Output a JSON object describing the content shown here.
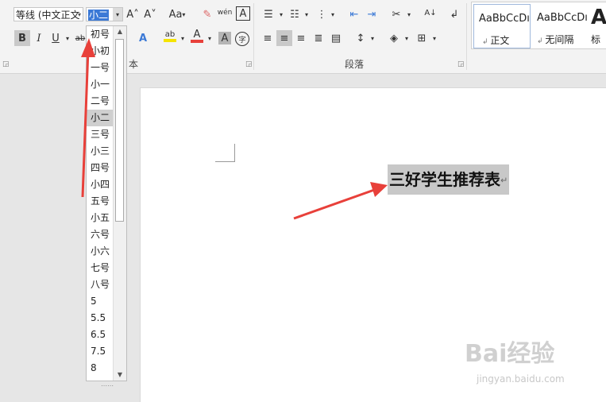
{
  "font_group": {
    "font_name": "等线 (中文正文",
    "font_size": "小二",
    "grow_icon": "A˄",
    "shrink_icon": "A˅",
    "case_label": "Aa",
    "phonetic_label": "wén",
    "border_label": "A",
    "bold": "B",
    "italic": "I",
    "underline": "U",
    "strike": "ab",
    "font_color_label": "A",
    "highlight_label": "ab",
    "shade_label": "A",
    "enclose_label": "字",
    "group_label": "本"
  },
  "paragraph_group": {
    "group_label": "段落"
  },
  "styles": [
    {
      "sample": "AaBbCcDı",
      "name": "正文"
    },
    {
      "sample": "AaBbCcDı",
      "name": "无间隔"
    },
    {
      "sample": "A",
      "name": "标"
    }
  ],
  "document": {
    "title_text": "三好学生推荐表",
    "paragraph_mark": "↵"
  },
  "font_size_list": {
    "items": [
      "初号",
      "小初",
      "一号",
      "小一",
      "二号",
      "小二",
      "三号",
      "小三",
      "四号",
      "小四",
      "五号",
      "小五",
      "六号",
      "小六",
      "七号",
      "八号",
      "5",
      "5.5",
      "6.5",
      "7.5",
      "8"
    ],
    "selected": "小二"
  },
  "watermark": {
    "brand": "Bai经验",
    "url": "jingyan.baidu.com"
  },
  "colors": {
    "accent_red": "#e8403a",
    "highlight_yellow": "#f5e400",
    "selection_gray": "#c8c8c8"
  }
}
